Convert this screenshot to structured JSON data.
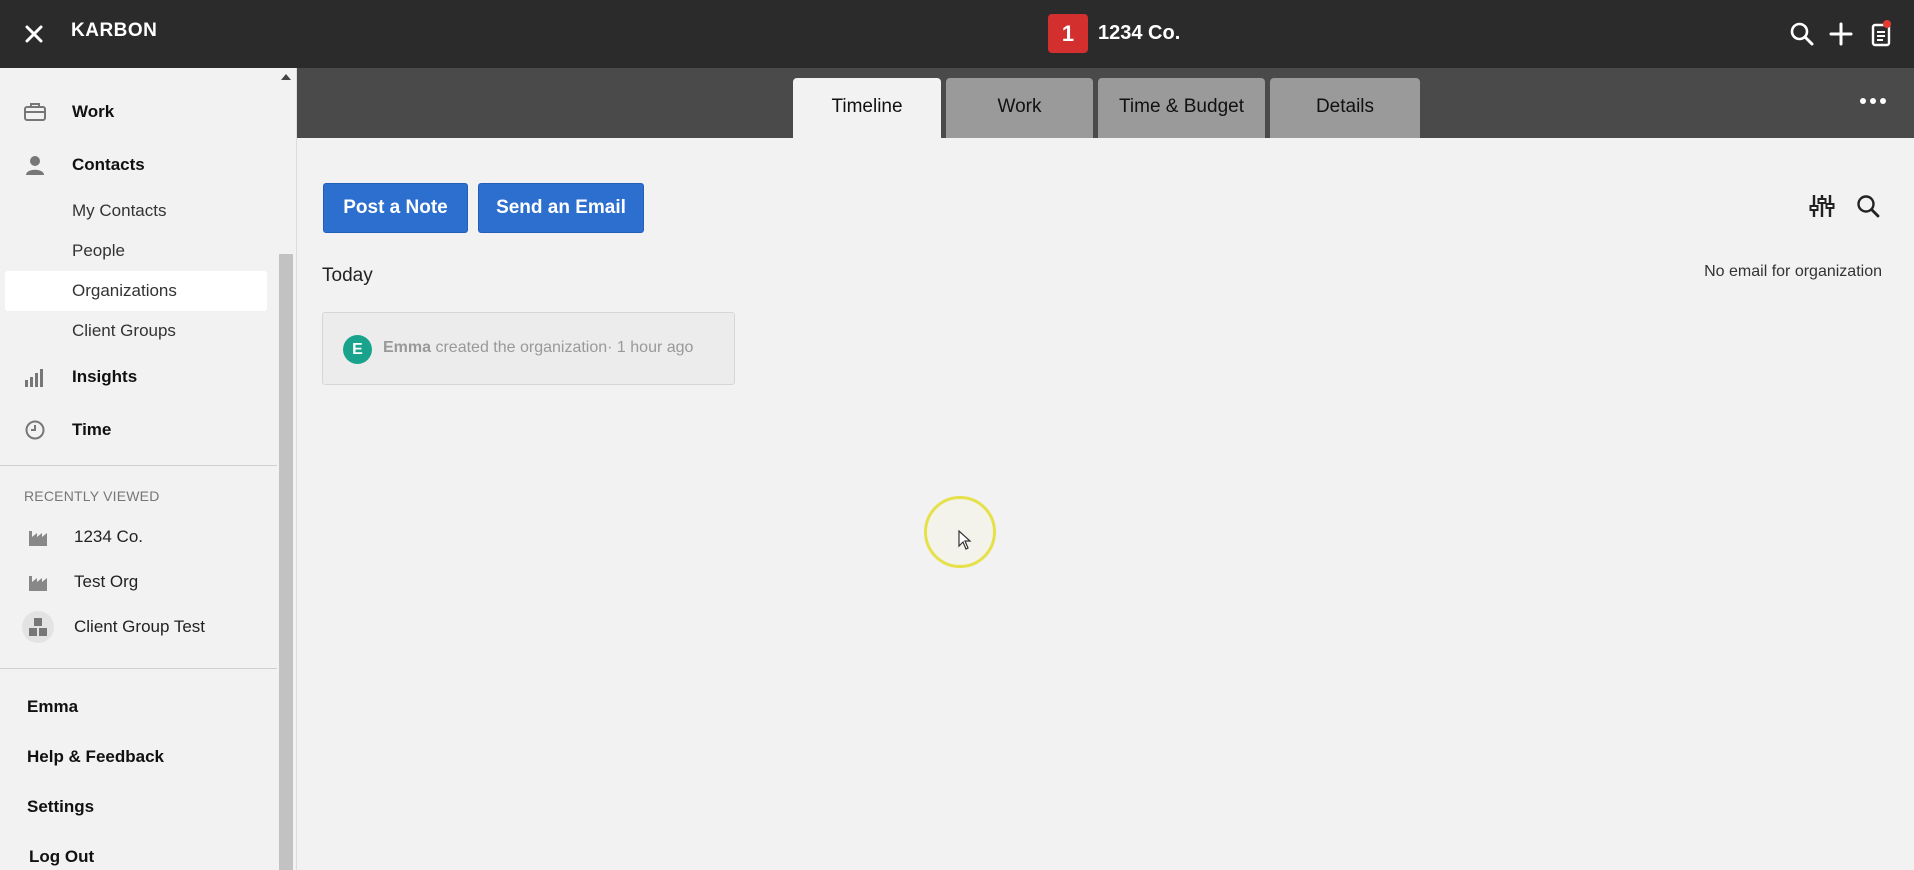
{
  "app": {
    "brand": "KARBON"
  },
  "header": {
    "org_badge": "1",
    "org_name": "1234 Co."
  },
  "tabs": [
    {
      "label": "Timeline",
      "active": true
    },
    {
      "label": "Work",
      "active": false
    },
    {
      "label": "Time & Budget",
      "active": false
    },
    {
      "label": "Details",
      "active": false
    }
  ],
  "sidebar": {
    "nav": [
      {
        "label": "Work",
        "icon": "briefcase-icon"
      },
      {
        "label": "Contacts",
        "icon": "person-icon"
      },
      {
        "label": "Insights",
        "icon": "bar-chart-icon"
      },
      {
        "label": "Time",
        "icon": "clock-icon"
      }
    ],
    "contacts_sub": [
      {
        "label": "My Contacts",
        "selected": false
      },
      {
        "label": "People",
        "selected": false
      },
      {
        "label": "Organizations",
        "selected": true
      },
      {
        "label": "Client Groups",
        "selected": false
      }
    ],
    "recently_viewed_title": "RECENTLY VIEWED",
    "recent": [
      {
        "label": "1234 Co.",
        "icon": "factory-icon"
      },
      {
        "label": "Test Org",
        "icon": "factory-icon"
      },
      {
        "label": "Client Group Test",
        "icon": "client-group-icon"
      }
    ],
    "footer": {
      "user": "Emma",
      "help": "Help & Feedback",
      "settings": "Settings",
      "logout": "Log Out"
    }
  },
  "main": {
    "post_note_label": "Post a Note",
    "send_email_label": "Send an Email",
    "today_label": "Today",
    "no_email_text": "No email for organization",
    "timeline": [
      {
        "avatar_letter": "E",
        "who": "Emma",
        "action": " created the organization",
        "time": "· 1 hour ago"
      }
    ]
  },
  "colors": {
    "topbar": "#2b2b2b",
    "subbar": "#4a4a4a",
    "accent_button": "#2d6fcf",
    "badge_red": "#d32f2f",
    "avatar_teal": "#1aa38c"
  }
}
